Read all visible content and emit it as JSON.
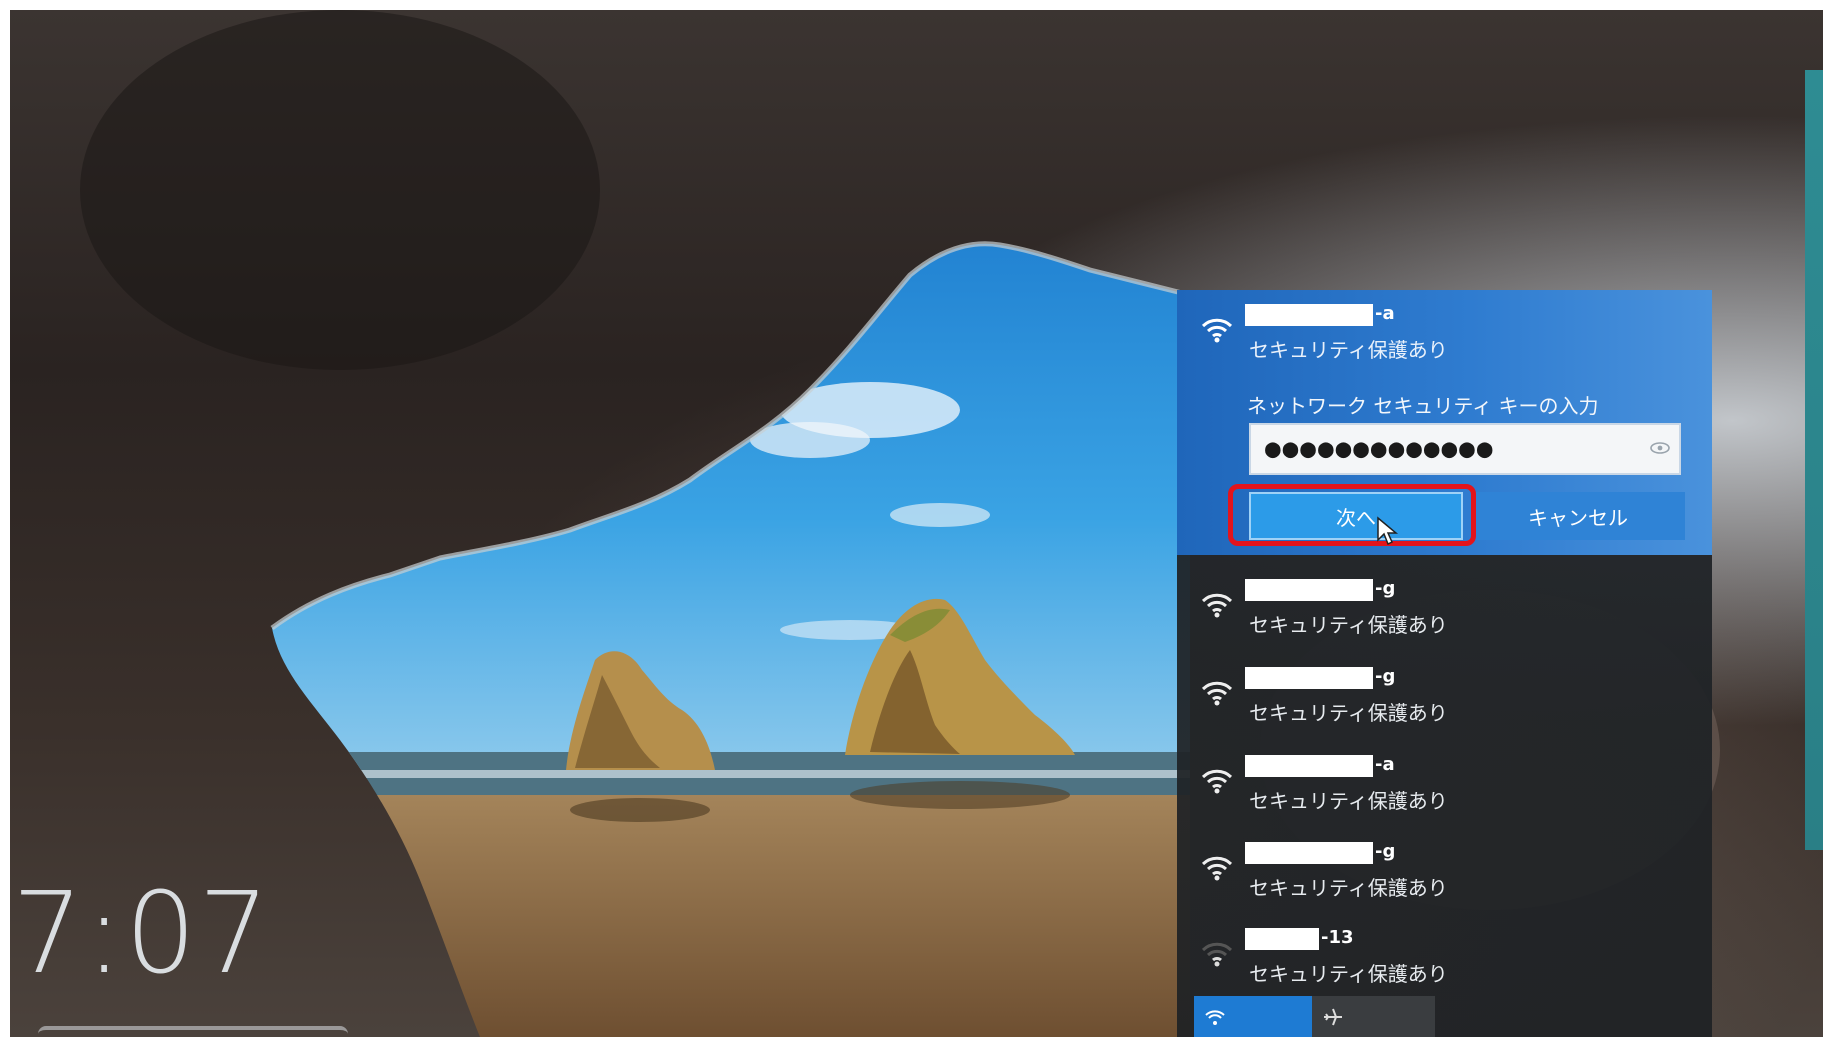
{
  "lock_screen": {
    "time": "7:07"
  },
  "network_flyout": {
    "selected": {
      "name_suffix": "-a",
      "security": "セキュリティ保護あり",
      "key_label": "ネットワーク セキュリティ キーの入力",
      "key_value": "●●●●●●●●●●●●●",
      "next_label": "次へ",
      "cancel_label": "キャンセル"
    },
    "networks": [
      {
        "name_suffix": "-g",
        "security": "セキュリティ保護あり",
        "icon": "wifi-icon"
      },
      {
        "name_suffix": "-g",
        "security": "セキュリティ保護あり",
        "icon": "wifi-icon"
      },
      {
        "name_suffix": "-a",
        "security": "セキュリティ保護あり",
        "icon": "wifi-icon"
      },
      {
        "name_suffix": "-g",
        "security": "セキュリティ保護あり",
        "icon": "wifi-icon"
      },
      {
        "name_suffix": "-13",
        "security": "セキュリティ保護あり",
        "icon": "wifi-weak-icon"
      }
    ],
    "quick_tiles": [
      {
        "icon": "wifi-icon",
        "state": "on"
      },
      {
        "icon": "airplane-icon",
        "state": "off"
      }
    ]
  },
  "colors": {
    "flyout_bg": "#222629",
    "selected_bg": "#2f7cd0",
    "next_button": "#2c9be8",
    "highlight": "#e3141c",
    "wifi_tile": "#1e7bd3"
  }
}
